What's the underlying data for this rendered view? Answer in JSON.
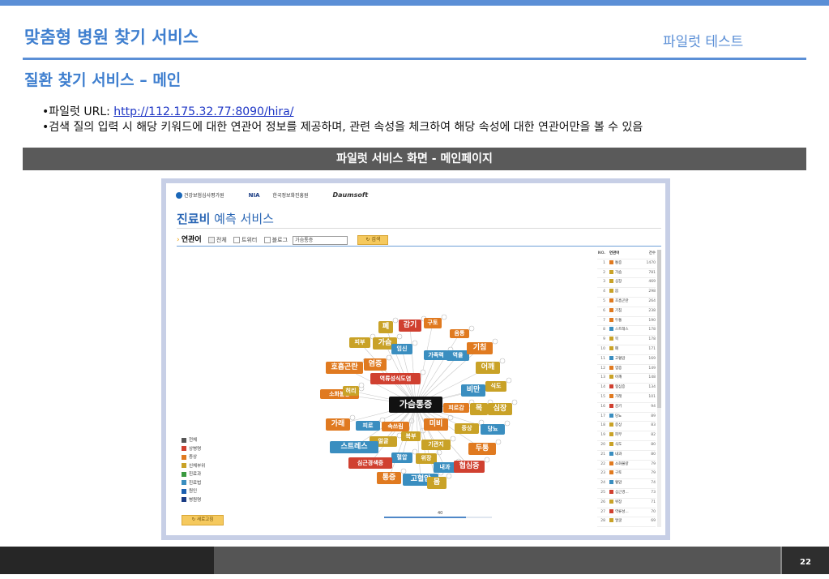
{
  "slide": {
    "title": "맞춤형 병원 찾기 서비스",
    "title_right": "파일럿 테스트",
    "section": "질환 찾기 서비스 – 메인",
    "bullet1_prefix": "•파일럿 URL: ",
    "bullet1_link": "http://112.175.32.77:8090/hira/",
    "bullet2": "•검색 질의 입력 시 해당 키워드에 대한 연관어 정보를 제공하며, 관련 속성을 체크하여 해당 속성에 대한 연관어만을 볼 수 있음",
    "banner": "파일럿 서비스 화면 - 메인페이지",
    "page_number": "22"
  },
  "app": {
    "logos": [
      "건강보험심사평가원",
      "NIA",
      "한국정보화진흥원",
      "Daumsoft"
    ],
    "title_bold": "진료비",
    "title_rest": " 예측 서비스",
    "toolbar": {
      "label": "연관어",
      "options": [
        "전체",
        "트위터",
        "블로그"
      ],
      "query": "가슴통증",
      "search_button": "검색"
    },
    "center_node": "가슴통증",
    "nodes": [
      {
        "label": "폐",
        "color": "#c9a227"
      },
      {
        "label": "감기",
        "color": "#d04030"
      },
      {
        "label": "구토",
        "color": "#e07a20"
      },
      {
        "label": "음통",
        "color": "#e07a20"
      },
      {
        "label": "피부",
        "color": "#c9a227"
      },
      {
        "label": "가슴",
        "color": "#c9a227"
      },
      {
        "label": "임신",
        "color": "#3a8ec0"
      },
      {
        "label": "가족력",
        "color": "#3a8ec0"
      },
      {
        "label": "역을",
        "color": "#3a8ec0"
      },
      {
        "label": "기침",
        "color": "#e07a20"
      },
      {
        "label": "호흡곤란",
        "color": "#e07a20"
      },
      {
        "label": "염증",
        "color": "#e07a20"
      },
      {
        "label": "어깨",
        "color": "#c9a227"
      },
      {
        "label": "역류성식도염",
        "color": "#d04030"
      },
      {
        "label": "비만",
        "color": "#3a8ec0"
      },
      {
        "label": "식도",
        "color": "#c9a227"
      },
      {
        "label": "소화불량",
        "color": "#e07a20"
      },
      {
        "label": "허리",
        "color": "#c9a227"
      },
      {
        "label": "피로감",
        "color": "#e07a20"
      },
      {
        "label": "목",
        "color": "#c9a227"
      },
      {
        "label": "심장",
        "color": "#c9a227"
      },
      {
        "label": "가래",
        "color": "#e07a20"
      },
      {
        "label": "피로",
        "color": "#3a8ec0"
      },
      {
        "label": "속쓰림",
        "color": "#e07a20"
      },
      {
        "label": "미비",
        "color": "#e07a20"
      },
      {
        "label": "증상",
        "color": "#c9a227"
      },
      {
        "label": "당뇨",
        "color": "#3a8ec0"
      },
      {
        "label": "복부",
        "color": "#c9a227"
      },
      {
        "label": "얼굴",
        "color": "#c9a227"
      },
      {
        "label": "기관지",
        "color": "#c9a227"
      },
      {
        "label": "스트레스",
        "color": "#3a8ec0"
      },
      {
        "label": "두통",
        "color": "#e07a20"
      },
      {
        "label": "혈압",
        "color": "#3a8ec0"
      },
      {
        "label": "위장",
        "color": "#c9a227"
      },
      {
        "label": "심근경색증",
        "color": "#d04030"
      },
      {
        "label": "내과",
        "color": "#3a8ec0"
      },
      {
        "label": "협심증",
        "color": "#d04030"
      },
      {
        "label": "통증",
        "color": "#e07a20"
      },
      {
        "label": "고혈압",
        "color": "#3a8ec0"
      },
      {
        "label": "몸",
        "color": "#c9a227"
      }
    ],
    "legend": [
      {
        "label": "전체",
        "color": "#555555"
      },
      {
        "label": "상병명",
        "color": "#d04030"
      },
      {
        "label": "증상",
        "color": "#e07a20"
      },
      {
        "label": "신체부위",
        "color": "#c9a227"
      },
      {
        "label": "진료과",
        "color": "#3a9a40"
      },
      {
        "label": "진료법",
        "color": "#3a8ec0"
      },
      {
        "label": "원인",
        "color": "#1a5fb0"
      },
      {
        "label": "병원명",
        "color": "#1a3c84"
      }
    ],
    "reset_button": "새로고침",
    "slider_value": "40",
    "table": {
      "headers": [
        "NO.",
        "연관어",
        "건수"
      ],
      "rows": [
        {
          "no": "1",
          "term": "통증",
          "count": "1470",
          "color": "#e07a20"
        },
        {
          "no": "2",
          "term": "가슴",
          "count": "781",
          "color": "#c9a227"
        },
        {
          "no": "3",
          "term": "심장",
          "count": "469",
          "color": "#c9a227"
        },
        {
          "no": "4",
          "term": "몸",
          "count": "298",
          "color": "#c9a227"
        },
        {
          "no": "5",
          "term": "호흡곤란",
          "count": "264",
          "color": "#e07a20"
        },
        {
          "no": "6",
          "term": "기침",
          "count": "238",
          "color": "#e07a20"
        },
        {
          "no": "7",
          "term": "두통",
          "count": "190",
          "color": "#e07a20"
        },
        {
          "no": "8",
          "term": "스트레스",
          "count": "178",
          "color": "#3a8ec0"
        },
        {
          "no": "9",
          "term": "목",
          "count": "178",
          "color": "#c9a227"
        },
        {
          "no": "10",
          "term": "폐",
          "count": "171",
          "color": "#c9a227"
        },
        {
          "no": "11",
          "term": "고혈압",
          "count": "169",
          "color": "#3a8ec0"
        },
        {
          "no": "12",
          "term": "염증",
          "count": "149",
          "color": "#e07a20"
        },
        {
          "no": "13",
          "term": "어깨",
          "count": "148",
          "color": "#c9a227"
        },
        {
          "no": "14",
          "term": "협심증",
          "count": "134",
          "color": "#d04030"
        },
        {
          "no": "15",
          "term": "가래",
          "count": "101",
          "color": "#e07a20"
        },
        {
          "no": "16",
          "term": "감기",
          "count": "94",
          "color": "#d04030"
        },
        {
          "no": "17",
          "term": "당뇨",
          "count": "89",
          "color": "#3a8ec0"
        },
        {
          "no": "18",
          "term": "증상",
          "count": "83",
          "color": "#c9a227"
        },
        {
          "no": "19",
          "term": "피부",
          "count": "82",
          "color": "#c9a227"
        },
        {
          "no": "20",
          "term": "식도",
          "count": "80",
          "color": "#c9a227"
        },
        {
          "no": "21",
          "term": "내과",
          "count": "80",
          "color": "#3a8ec0"
        },
        {
          "no": "22",
          "term": "소화불량",
          "count": "79",
          "color": "#e07a20"
        },
        {
          "no": "23",
          "term": "구토",
          "count": "79",
          "color": "#e07a20"
        },
        {
          "no": "24",
          "term": "혈압",
          "count": "74",
          "color": "#3a8ec0"
        },
        {
          "no": "25",
          "term": "심근경...",
          "count": "73",
          "color": "#d04030"
        },
        {
          "no": "26",
          "term": "위장",
          "count": "71",
          "color": "#c9a227"
        },
        {
          "no": "27",
          "term": "역류성...",
          "count": "70",
          "color": "#d04030"
        },
        {
          "no": "28",
          "term": "얼굴",
          "count": "69",
          "color": "#c9a227"
        }
      ]
    }
  }
}
